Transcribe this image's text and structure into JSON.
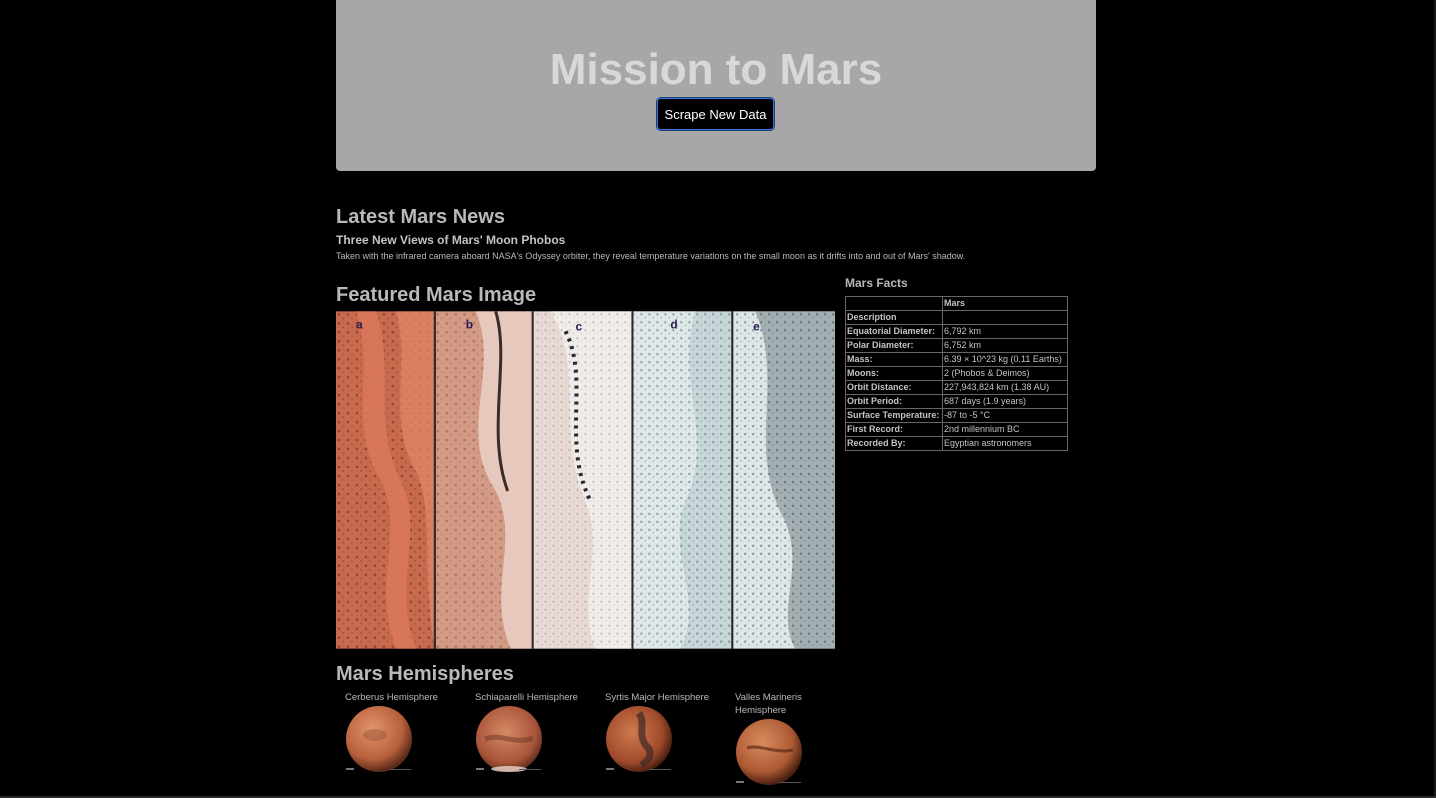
{
  "header": {
    "title": "Mission to Mars",
    "scrape_label": "Scrape New Data"
  },
  "news": {
    "heading": "Latest Mars News",
    "title": "Three New Views of Mars' Moon Phobos",
    "paragraph": "Taken with the infrared camera aboard NASA's Odyssey orbiter, they reveal temperature variations on the small moon as it drifts into and out of Mars' shadow."
  },
  "featured": {
    "heading": "Featured Mars Image",
    "panel_labels": [
      "a",
      "b",
      "c",
      "d",
      "e"
    ]
  },
  "facts": {
    "heading": "Mars Facts",
    "column_header": "Mars",
    "first_row_label": "Description",
    "rows": [
      {
        "label": "Equatorial Diameter:",
        "value": "6,792 km"
      },
      {
        "label": "Polar Diameter:",
        "value": "6,752 km"
      },
      {
        "label": "Mass:",
        "value": "6.39 × 10^23 kg (0.11 Earths)"
      },
      {
        "label": "Moons:",
        "value": "2 (Phobos & Deimos)"
      },
      {
        "label": "Orbit Distance:",
        "value": "227,943,824 km (1.38 AU)"
      },
      {
        "label": "Orbit Period:",
        "value": "687 days (1.9 years)"
      },
      {
        "label": "Surface Temperature:",
        "value": "-87 to -5 °C"
      },
      {
        "label": "First Record:",
        "value": "2nd millennium BC"
      },
      {
        "label": "Recorded By:",
        "value": "Egyptian astronomers"
      }
    ]
  },
  "hemispheres": {
    "heading": "Mars Hemispheres",
    "items": [
      {
        "name": "Cerberus Hemisphere"
      },
      {
        "name": "Schiaparelli Hemisphere"
      },
      {
        "name": "Syrtis Major Hemisphere"
      },
      {
        "name": "Valles Marineris Hemisphere"
      }
    ]
  },
  "colors": {
    "page_bg": "#000000",
    "jumbotron_bg": "#a7a7a7",
    "text": "#b9b9b9",
    "button_border": "#3a6fd8"
  }
}
